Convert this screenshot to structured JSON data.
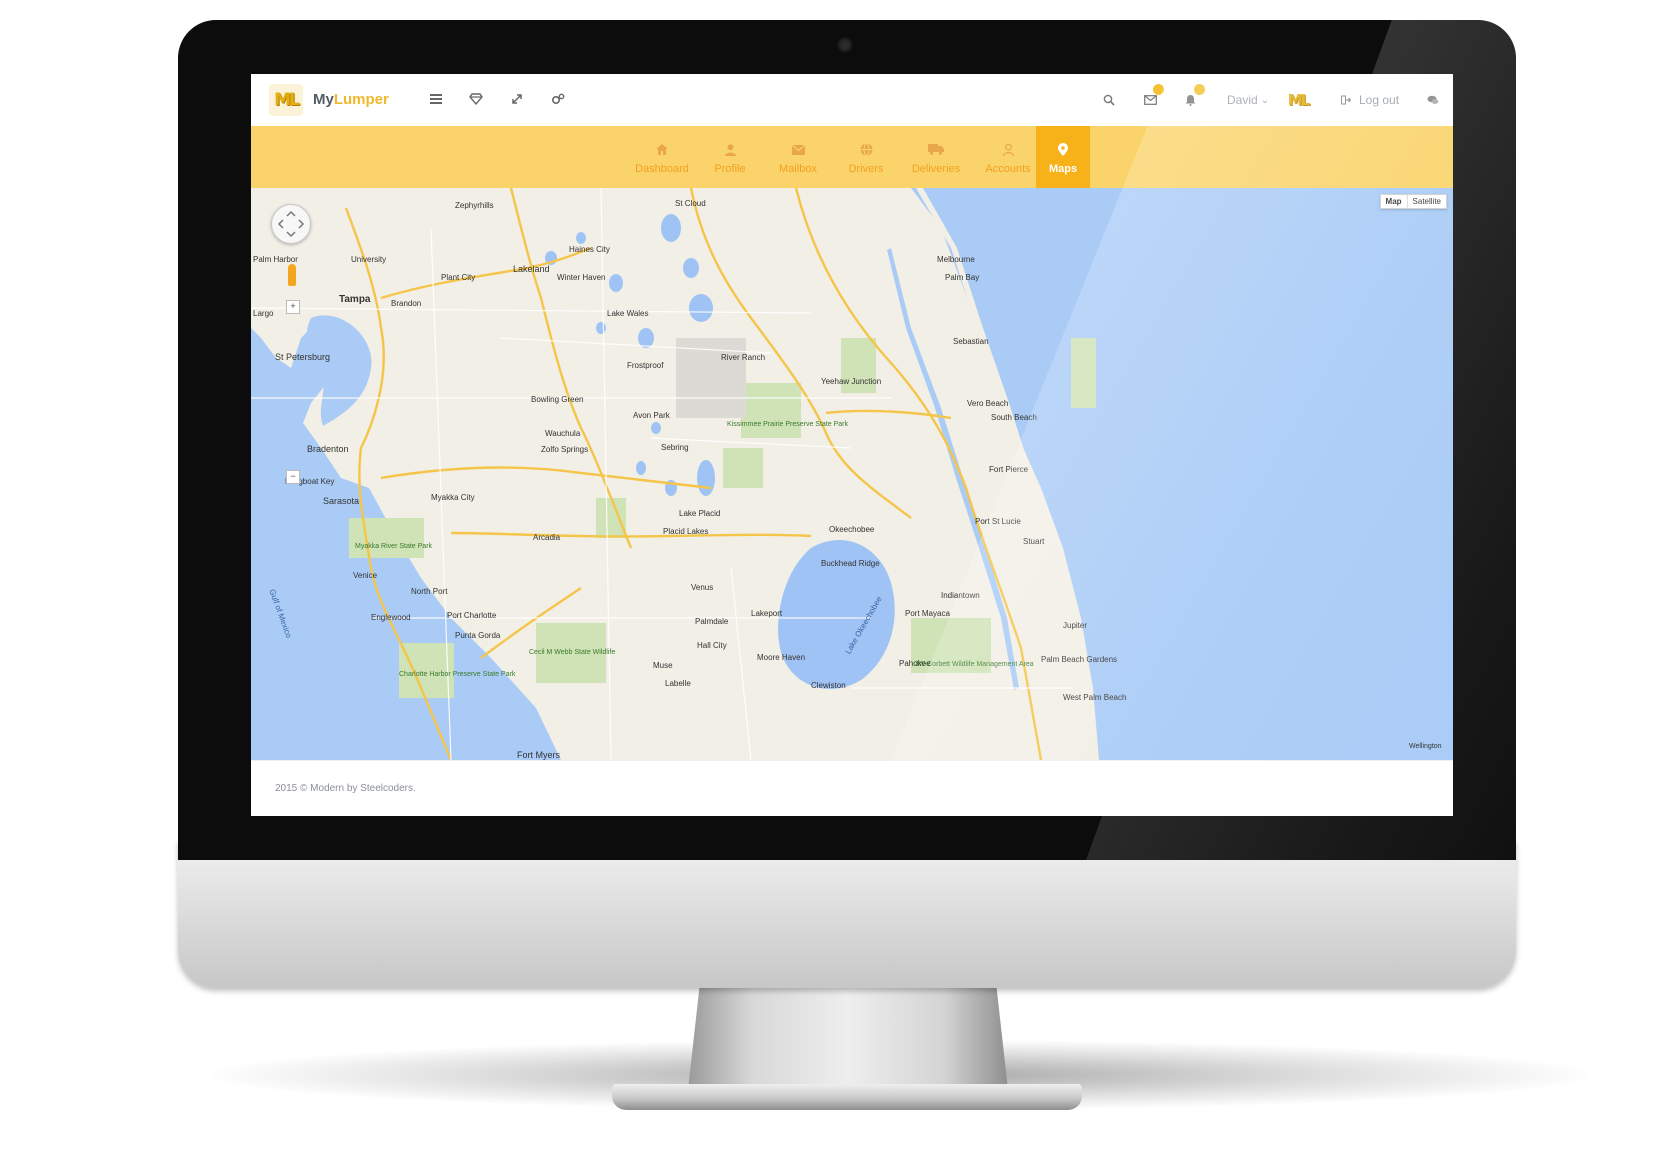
{
  "app": {
    "logo_text": "ML",
    "brand_part1": "My",
    "brand_part2": "Lumper",
    "brand_color": "#f0b82c"
  },
  "toolbar": {
    "icons": [
      "menu-icon",
      "diamond-icon",
      "expand-icon",
      "settings-icon"
    ]
  },
  "header_right": {
    "search_icon": "search-icon",
    "mail_badge": "",
    "notify_badge": "",
    "user_name": "David",
    "user_caret": "⌄",
    "logout_label": "Log out",
    "chat_icon": "chat-icon"
  },
  "nav": {
    "accent": "#fad46a",
    "active_color": "#f7b21a",
    "items": [
      {
        "label": "Dashboard",
        "icon": "home-icon"
      },
      {
        "label": "Profile",
        "icon": "user-icon"
      },
      {
        "label": "Mailbox",
        "icon": "mail-icon"
      },
      {
        "label": "Drivers",
        "icon": "globe-icon"
      },
      {
        "label": "Deliveries",
        "icon": "truck-icon"
      },
      {
        "label": "Accounts",
        "icon": "account-icon"
      },
      {
        "label": "Maps",
        "icon": "map-pin-icon"
      }
    ]
  },
  "map": {
    "type_map": "Map",
    "type_satellite": "Satellite",
    "zoom_in": "+",
    "zoom_out": "−",
    "places": {
      "tampa": "Tampa",
      "st_petersburg": "St Petersburg",
      "lakeland": "Lakeland",
      "plant_city": "Plant City",
      "winter_haven": "Winter Haven",
      "brandon": "Brandon",
      "lake_wales": "Lake Wales",
      "bradenton": "Bradenton",
      "sarasota": "Sarasota",
      "venice": "Venice",
      "north_port": "North Port",
      "port_charlotte": "Port Charlotte",
      "punta_gorda": "Punta Gorda",
      "fort_myers": "Fort Myers",
      "arcadia": "Arcadia",
      "wauchula": "Wauchula",
      "sebring": "Sebring",
      "avon_park": "Avon Park",
      "lake_placid": "Lake Placid",
      "okeechobee": "Okeechobee",
      "melbourne": "Melbourne",
      "palm_bay": "Palm Bay",
      "sebastian": "Sebastian",
      "vero_beach": "Vero Beach",
      "fort_pierce": "Fort Pierce",
      "port_st_lucie": "Port St Lucie",
      "stuart": "Stuart",
      "jupiter": "Jupiter",
      "palm_beach_gardens": "Palm Beach Gardens",
      "west_palm_beach": "West Palm Beach",
      "lake_okeechobee": "Lake Okeechobee",
      "clewiston": "Clewiston",
      "lakeport": "Lakeport",
      "palmdale": "Palmdale",
      "moore_haven": "Moore Haven",
      "port_mayaca": "Port Mayaca",
      "indiantown": "Indiantown",
      "pahokee": "Pahokee",
      "haines_city": "Haines City",
      "bowling_green": "Bowling Green",
      "zolfo_springs": "Zolfo Springs",
      "myakka_city": "Myakka City",
      "englewood": "Englewood",
      "yeehaw_junction": "Yeehaw Junction",
      "river_ranch": "River Ranch",
      "frostproof": "Frostproof",
      "placid_lakes": "Placid Lakes",
      "venus": "Venus",
      "muse": "Muse",
      "labelle": "Labelle",
      "hall_city": "Hall City",
      "buckhead_ridge": "Buckhead Ridge",
      "kissimmee_prairie": "Kissimmee Prairie Preserve State Park",
      "myakka_river": "Myakka River State Park",
      "cecil_webb": "Cecil M Webb State Wildlife",
      "charlotte_harbor": "Charlotte Harbor Preserve State Park",
      "jw_corbett": "JW Corbett Wildlife Management Area",
      "st_cloud": "St Cloud",
      "zephyrhills": "Zephyrhills",
      "gulf_of_mexico": "Gulf of Mexico",
      "university": "University",
      "largo": "Largo",
      "pine_harbor": "Palm Harbor",
      "south_beach": "South Beach",
      "longboat_key": "Longboat Key",
      "wellington": "Wellington"
    }
  },
  "footer": {
    "text": "2015 © Modern by Steelcoders."
  }
}
